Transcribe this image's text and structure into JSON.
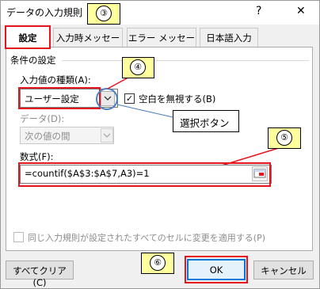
{
  "window": {
    "title": "データの入力規則",
    "help": "?",
    "close": "✕"
  },
  "tabs": [
    {
      "label": "設定",
      "active": true
    },
    {
      "label": "入力時メッセージ",
      "active": false
    },
    {
      "label": "エラー メッセージ",
      "active": false
    },
    {
      "label": "日本語入力",
      "active": false
    }
  ],
  "criteria": {
    "group_label": "条件の設定",
    "allow_label": "入力値の種類(A):",
    "allow_value": "ユーザー設定",
    "ignore_blank_label": "空白を無視する(B)",
    "ignore_blank_checked": true,
    "data_label": "データ(D):",
    "data_value": "次の値の間",
    "formula_label": "数式(F):",
    "formula_value": "=countif($A$3:$A$7,A3)=1"
  },
  "apply_all_label": "同じ入力規則が設定されたすべてのセルに変更を適用する(P)",
  "buttons": {
    "clear_all": "すべてクリア(C)",
    "ok": "OK",
    "cancel": "キャンセル"
  },
  "annotations": {
    "step3": "③",
    "step4": "④",
    "step5": "⑤",
    "step6": "⑥",
    "callout_text": "選択ボタン"
  },
  "colors": {
    "highlight_red": "#e5141d",
    "circle_blue": "#4a7fc1",
    "callout_yellow": "#ffff9e"
  }
}
